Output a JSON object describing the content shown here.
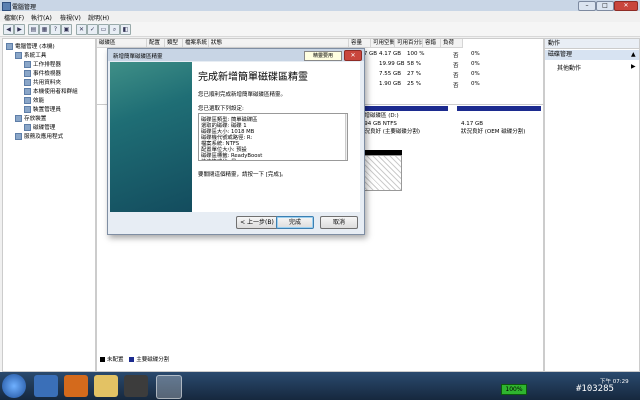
{
  "window": {
    "title": "電腦管理",
    "min": "–",
    "max": "□",
    "close": "✕"
  },
  "menu": [
    "檔案(F)",
    "執行(A)",
    "檢視(V)",
    "說明(H)"
  ],
  "tree": [
    {
      "label": "電腦管理 (本機)",
      "indent": 0
    },
    {
      "label": "系統工具",
      "indent": 1
    },
    {
      "label": "工作排程器",
      "indent": 2
    },
    {
      "label": "事件檢視器",
      "indent": 2
    },
    {
      "label": "共用資料夾",
      "indent": 2
    },
    {
      "label": "本機使用者和群組",
      "indent": 2
    },
    {
      "label": "效能",
      "indent": 2
    },
    {
      "label": "裝置管理員",
      "indent": 2
    },
    {
      "label": "存放裝置",
      "indent": 1
    },
    {
      "label": "磁碟管理",
      "indent": 2
    },
    {
      "label": "服務及應用程式",
      "indent": 1
    }
  ],
  "volume_table": {
    "headers": [
      "磁碟區",
      "配置",
      "類型",
      "檔案系統",
      "狀態",
      "容量",
      "可用空間",
      "可用百分比",
      "容錯",
      "負荷"
    ],
    "rows": [
      {
        "cap": "4.17 GB",
        "free": "4.17 GB",
        "pct": "100 %",
        "ft": "否",
        "ov": "0%"
      },
      {
        "cap": "GB",
        "free": "19.99 GB",
        "pct": "58 %",
        "ft": "否",
        "ov": "0%"
      },
      {
        "cap": "GB",
        "free": "7.55 GB",
        "pct": "27 %",
        "ft": "否",
        "ov": "0%"
      },
      {
        "cap": "GB",
        "free": "1.90 GB",
        "pct": "25 %",
        "ft": "否",
        "ov": "0%"
      }
    ]
  },
  "disk_map": {
    "part1": {
      "name": "新增磁碟區 (D:)",
      "size": "9.94 GB NTFS",
      "status": "狀況良好 (主要磁碟分割)"
    },
    "part2": {
      "name": "4.17 GB",
      "status": "狀況良好 (OEM 磁碟分割)"
    }
  },
  "legend": {
    "unalloc": "未配置",
    "primary": "主要磁碟分割"
  },
  "actions": {
    "header": "動作",
    "section": "磁碟管理",
    "more": "其他動作"
  },
  "wizard": {
    "title": "新增簡單磁碟區精靈",
    "tooltip": "精靈要用",
    "heading": "完成新增簡單磁碟區精靈",
    "desc": "您已順利完成新增簡單磁碟區精靈。",
    "selected_label": "您已選取下列設定:",
    "settings": [
      "磁碟區類型: 簡單磁碟區",
      "選取的磁碟: 磁碟 1",
      "磁碟區大小: 1018 MB",
      "磁碟機代號或路徑: R:",
      "檔案系統: NTFS",
      "配置單位大小: 預設",
      "磁碟區標籤: ReadyBoost",
      "快速格式化: 是"
    ],
    "close_note": "要關閉這個精靈，請按一下 [完成]。",
    "back": "< 上一步(B)",
    "finish": "完成",
    "cancel": "取消"
  },
  "taskbar": {
    "battery": "100%",
    "clock": "下午 07:29",
    "watermark": "#103285"
  },
  "colors": {
    "partition_bar": "#1c2b8f",
    "wizard_side": "#1f6e75"
  }
}
